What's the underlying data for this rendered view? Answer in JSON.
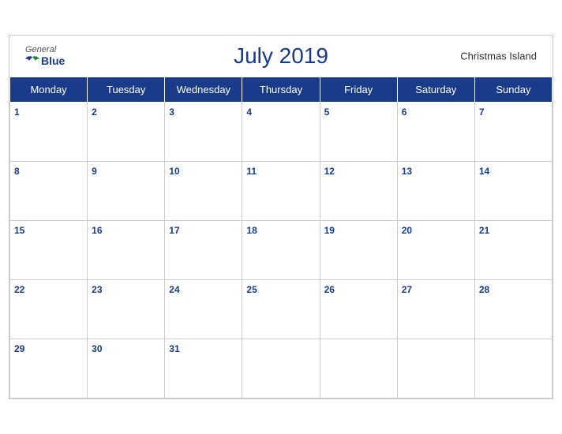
{
  "header": {
    "title": "July 2019",
    "region": "Christmas Island",
    "logo": {
      "general": "General",
      "blue": "Blue"
    }
  },
  "weekdays": [
    "Monday",
    "Tuesday",
    "Wednesday",
    "Thursday",
    "Friday",
    "Saturday",
    "Sunday"
  ],
  "weeks": [
    [
      1,
      2,
      3,
      4,
      5,
      6,
      7
    ],
    [
      8,
      9,
      10,
      11,
      12,
      13,
      14
    ],
    [
      15,
      16,
      17,
      18,
      19,
      20,
      21
    ],
    [
      22,
      23,
      24,
      25,
      26,
      27,
      28
    ],
    [
      29,
      30,
      31,
      null,
      null,
      null,
      null
    ]
  ]
}
